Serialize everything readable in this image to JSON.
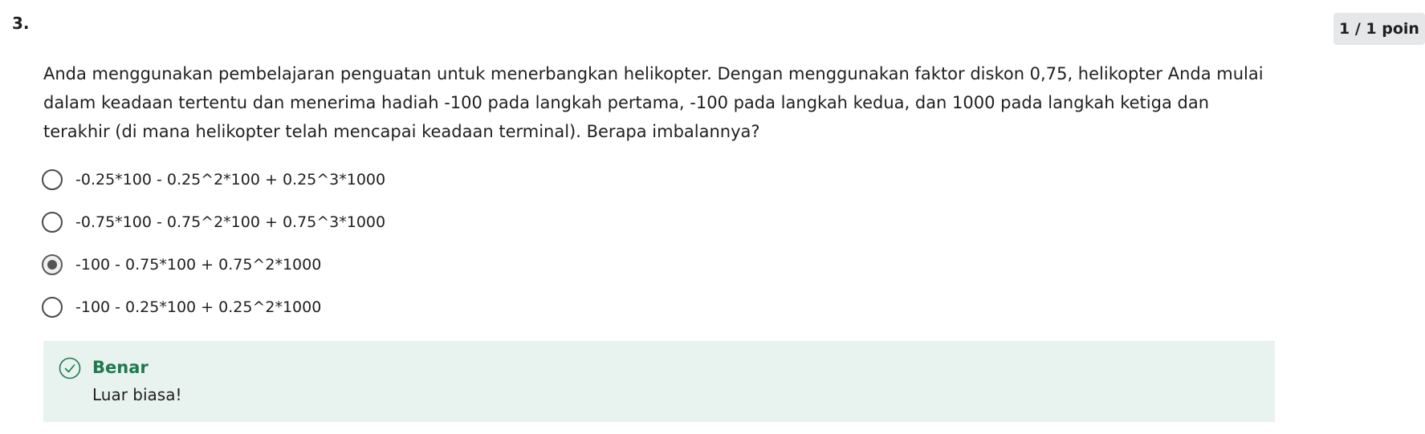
{
  "question": {
    "number": "3.",
    "points": "1 / 1 poin",
    "text": "Anda menggunakan pembelajaran penguatan untuk menerbangkan helikopter. Dengan menggunakan faktor diskon 0,75, helikopter Anda mulai dalam keadaan tertentu dan menerima hadiah -100 pada langkah pertama, -100 pada langkah kedua, dan 1000 pada langkah ketiga dan terakhir (di mana helikopter telah mencapai keadaan terminal). Berapa imbalannya?"
  },
  "options": [
    {
      "label": "-0.25*100 - 0.25^2*100 + 0.25^3*1000",
      "selected": false
    },
    {
      "label": "-0.75*100 - 0.75^2*100 + 0.75^3*1000",
      "selected": false
    },
    {
      "label": "-100 - 0.75*100 + 0.75^2*1000",
      "selected": true
    },
    {
      "label": "-100 - 0.25*100 + 0.25^2*1000",
      "selected": false
    }
  ],
  "feedback": {
    "title": "Benar",
    "message": "Luar biasa!",
    "icon": "check-circle-icon",
    "accent_color": "#1f7a4d",
    "background_color": "#e8f2ee"
  }
}
